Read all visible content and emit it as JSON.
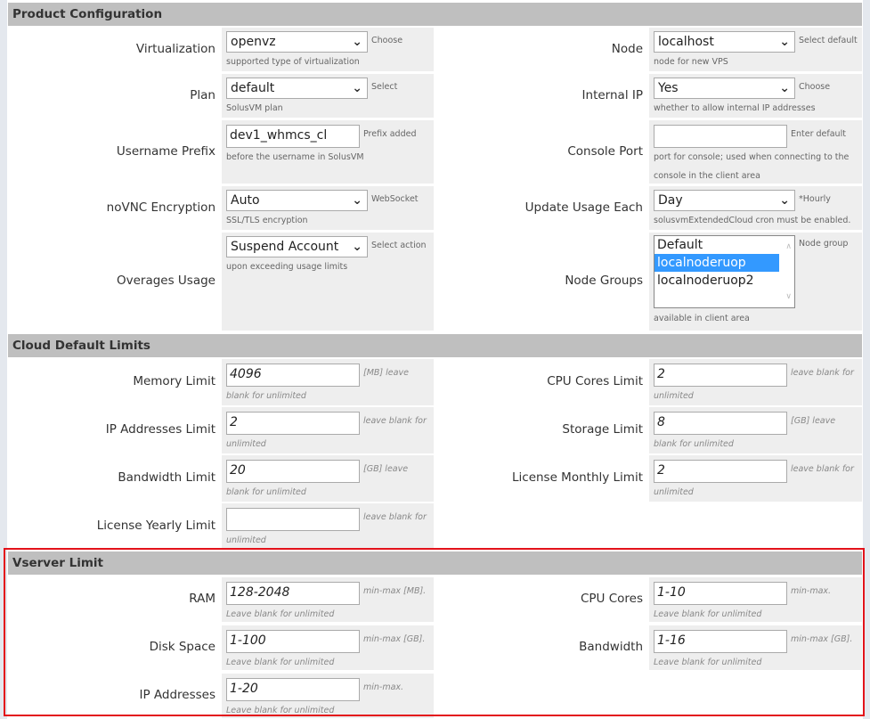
{
  "sections": [
    {
      "title": "Product Configuration",
      "rows": [
        {
          "left": {
            "label": "Virtualization",
            "type": "select",
            "value": "openvz",
            "help": "Choose supported type of virtualization"
          },
          "right": {
            "label": "Node",
            "type": "select",
            "value": "localhost",
            "help": "Select default node for new VPS"
          }
        },
        {
          "left": {
            "label": "Plan",
            "type": "select",
            "value": "default",
            "help": "Select SolusVM plan"
          },
          "right": {
            "label": "Internal IP",
            "type": "select",
            "value": "Yes",
            "help": "Choose whether to allow internal IP addresses"
          }
        },
        {
          "left": {
            "label": "Username Prefix",
            "type": "input",
            "value": "dev1_whmcs_cl",
            "help": "Prefix added before the username in SolusVM"
          },
          "right": {
            "label": "Console Port",
            "type": "input",
            "value": "",
            "help": "Enter default port for console; used when connecting to the console in the client area"
          }
        },
        {
          "left": {
            "label": "noVNC Encryption",
            "type": "select",
            "value": "Auto",
            "help": "WebSocket SSL/TLS encryption"
          },
          "right": {
            "label": "Update Usage Each",
            "type": "select",
            "value": "Day",
            "help": "*Hourly solusvmExtendedCloud cron must be enabled."
          }
        },
        {
          "left": {
            "label": "Overages Usage",
            "type": "select",
            "value": "Suspend Account",
            "help": "Select action upon exceeding usage limits"
          },
          "right": {
            "label": "Node Groups",
            "type": "list",
            "options": [
              "Default",
              "localnoderuop",
              "localnoderuop2"
            ],
            "selected": "localnoderuop",
            "help": "Node group available in client area"
          }
        }
      ]
    },
    {
      "title": "Cloud Default Limits",
      "rows": [
        {
          "left": {
            "label": "Memory Limit",
            "type": "input",
            "value": "4096",
            "help": "[MB] leave blank for unlimited"
          },
          "right": {
            "label": "CPU Cores Limit",
            "type": "input",
            "value": "2",
            "help": "leave blank for unlimited"
          }
        },
        {
          "left": {
            "label": "IP Addresses Limit",
            "type": "input",
            "value": "2",
            "help": "leave blank for unlimited"
          },
          "right": {
            "label": "Storage Limit",
            "type": "input",
            "value": "8",
            "help": "[GB] leave blank for unlimited"
          }
        },
        {
          "left": {
            "label": "Bandwidth Limit",
            "type": "input",
            "value": "20",
            "help": "[GB] leave blank for unlimited"
          },
          "right": {
            "label": "License Monthly Limit",
            "type": "input",
            "value": "2",
            "help": "leave blank for unlimited"
          }
        },
        {
          "left": {
            "label": "License Yearly Limit",
            "type": "input",
            "value": "",
            "help": "leave blank for unlimited"
          }
        }
      ]
    },
    {
      "title": "Vserver Limit",
      "rows": [
        {
          "left": {
            "label": "RAM",
            "type": "input",
            "value": "128-2048",
            "help": "min-max [MB]. Leave blank for unlimited"
          },
          "right": {
            "label": "CPU Cores",
            "type": "input",
            "value": "1-10",
            "help": "min-max. Leave blank for unlimited"
          }
        },
        {
          "left": {
            "label": "Disk Space",
            "type": "input",
            "value": "1-100",
            "help": "min-max [GB]. Leave blank for unlimited"
          },
          "right": {
            "label": "Bandwidth",
            "type": "input",
            "value": "1-16",
            "help": "min-max [GB]. Leave blank for unlimited"
          }
        },
        {
          "left": {
            "label": "IP Addresses",
            "type": "input",
            "value": "1-20",
            "help": "min-max. Leave blank for unlimited"
          }
        }
      ]
    }
  ],
  "colors": {
    "section_header": "#bfbfbf",
    "field_cell": "#eeeeee",
    "highlight_border": "#e3131b",
    "list_selected": "#3399ff"
  }
}
